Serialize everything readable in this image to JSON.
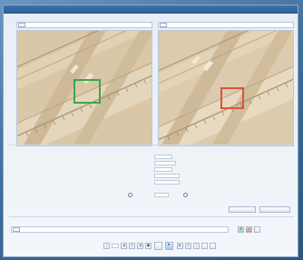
{
  "window": {
    "title": ""
  },
  "left_panel": {
    "label": "",
    "image_path": ""
  },
  "right_panel": {
    "label": "",
    "image_path": ""
  },
  "roi_colors": {
    "left": "#3fa646",
    "right": "#e0523c"
  },
  "settings": {
    "label": "",
    "fields": [
      {
        "label": "",
        "value": ""
      },
      {
        "label": "",
        "value": ""
      },
      {
        "label": "",
        "value": ""
      },
      {
        "label": "",
        "value": ""
      },
      {
        "label": "",
        "value": ""
      }
    ],
    "threshold_label": "",
    "threshold_value": "",
    "side_label": "",
    "button_a": "",
    "button_b": ""
  },
  "bottom": {
    "label": "",
    "image_path": "",
    "nav_label": "",
    "page_value": ""
  }
}
